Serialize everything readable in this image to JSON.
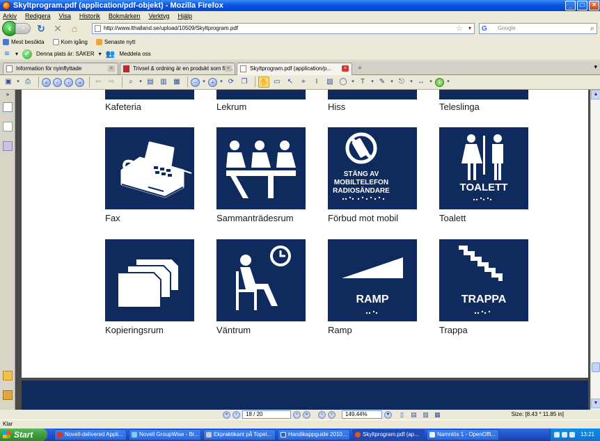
{
  "window": {
    "title": "Skyltprogram.pdf (application/pdf-objekt) - Mozilla Firefox"
  },
  "menu": [
    "Arkiv",
    "Redigera",
    "Visa",
    "Historik",
    "Bokmärken",
    "Verktyg",
    "Hjälp"
  ],
  "address": {
    "url": "http://www.lthalland.se/upload/10509/Skyltprogram.pdf"
  },
  "search": {
    "placeholder": "Google"
  },
  "bookmarks": [
    "Mest besökta",
    "Kom igång",
    "Senaste nytt"
  ],
  "security": {
    "site_status": "Denna plats är: SÄKER",
    "report": "Meddela oss"
  },
  "tabs": [
    {
      "label": "Information för nyinflyttade"
    },
    {
      "label": "Trivsel & ordning är en produkt som fin..."
    },
    {
      "label": "Skyltprogram.pdf (application/p..."
    }
  ],
  "colors": {
    "sign_blue": "#0f2a5c",
    "accent": "#245edb"
  },
  "signs_row0": [
    {
      "caption": "Kafeteria"
    },
    {
      "caption": "Lekrum"
    },
    {
      "caption": "Hiss"
    },
    {
      "caption": "Teleslinga"
    }
  ],
  "signs_row1": [
    {
      "caption": "Fax",
      "icon": "fax-machine-icon"
    },
    {
      "caption": "Sammanträdesrum",
      "icon": "meeting-room-icon"
    },
    {
      "caption": "Förbud mot mobil",
      "icon": "no-mobile-phone-icon",
      "sign_lines": [
        "STÄNG AV",
        "MOBILTELEFON",
        "RADIOSÄNDARE"
      ]
    },
    {
      "caption": "Toalett",
      "icon": "toilet-icon",
      "sign_lines": [
        "TOALETT"
      ]
    }
  ],
  "signs_row2": [
    {
      "caption": "Kopieringsrum",
      "icon": "copy-room-icon"
    },
    {
      "caption": "Väntrum",
      "icon": "waiting-room-icon"
    },
    {
      "caption": "Ramp",
      "icon": "ramp-icon",
      "sign_lines": [
        "RAMP"
      ]
    },
    {
      "caption": "Trappa",
      "icon": "stairs-icon",
      "sign_lines": [
        "TRAPPA"
      ]
    }
  ],
  "pdf_status": {
    "page": "18 / 20",
    "zoom": "149.44%",
    "size": "Size: [8.43 * 11.85 in]"
  },
  "status_text": "Klar",
  "taskbar": {
    "start": "Start",
    "items": [
      "Novell-delivered Appli...",
      "Novell GroupWise - Br...",
      "Ekpraktikant på Topel...",
      "Handikappguide 2010...",
      "Skyltprogram.pdf (ap...",
      "Namnlös 1 - OpenOffi..."
    ],
    "clock": "13:21"
  }
}
